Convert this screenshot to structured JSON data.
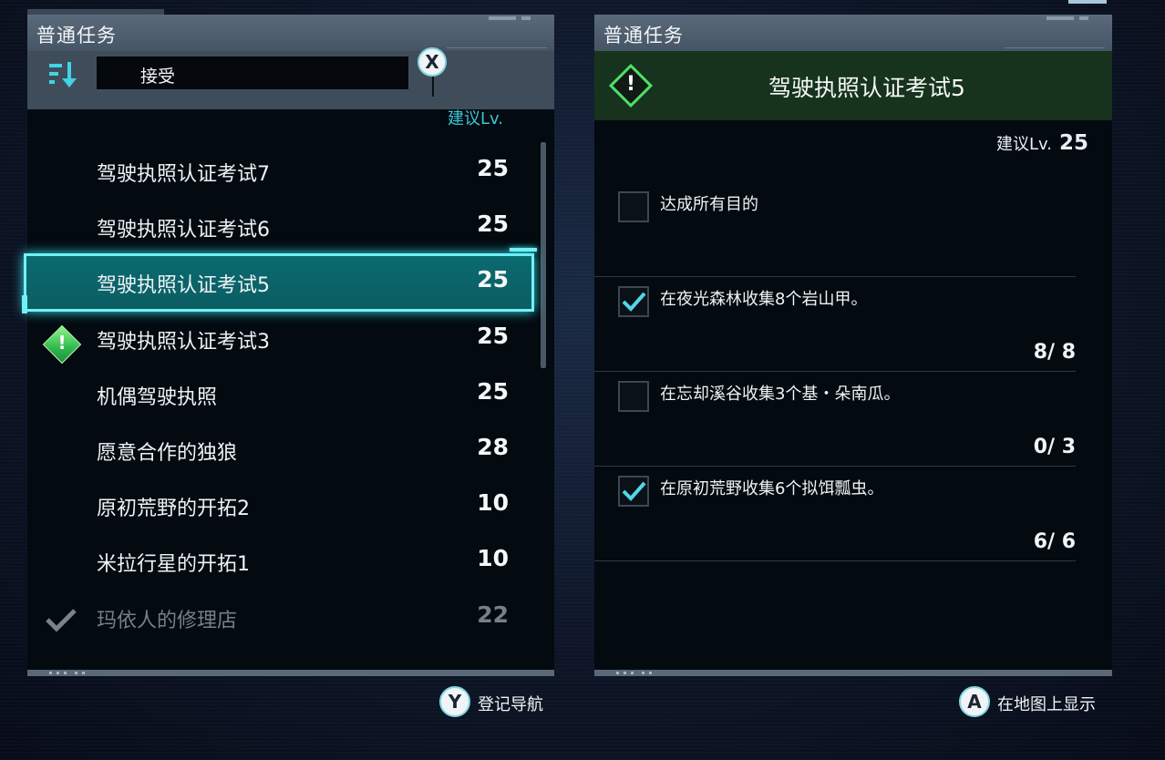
{
  "left_panel": {
    "title": "普通任务",
    "filter": "接受",
    "x_button": "X",
    "column_label": "建议Lv.",
    "quests": [
      {
        "name": "驾驶执照认证考试7",
        "level": "25"
      },
      {
        "name": "驾驶执照认证考试6",
        "level": "25"
      },
      {
        "name": "驾驶执照认证考试5",
        "level": "25"
      },
      {
        "name": "驾驶执照认证考试3",
        "level": "25"
      },
      {
        "name": "机偶驾驶执照",
        "level": "25"
      },
      {
        "name": "愿意合作的独狼",
        "level": "28"
      },
      {
        "name": "原初荒野的开拓2",
        "level": "10"
      },
      {
        "name": "米拉行星的开拓1",
        "level": "10"
      },
      {
        "name": "玛依人的修理店",
        "level": "22"
      }
    ]
  },
  "right_panel": {
    "title": "普通任务",
    "quest_title": "驾驶执照认证考试5",
    "rec_label": "建议Lv.",
    "rec_level": "25",
    "objectives": [
      {
        "text": "达成所有目的",
        "checked": false,
        "count": ""
      },
      {
        "text": "在夜光森林收集8个岩山甲。",
        "checked": true,
        "count": "8/ 8"
      },
      {
        "text": "在忘却溪谷收集3个基・朵南瓜。",
        "checked": false,
        "count": "0/ 3"
      },
      {
        "text": "在原初荒野收集6个拟饵瓢虫。",
        "checked": true,
        "count": "6/ 6"
      }
    ]
  },
  "hints": {
    "y_button": "Y",
    "y_label": "登记导航",
    "a_button": "A",
    "a_label": "在地图上显示"
  },
  "colors": {
    "accent": "#6ef2f7",
    "selected_bg": "#0b6469",
    "header_green": "#17331d",
    "diamond_green": "#2fb94e",
    "check_cyan": "#4fd8ea"
  }
}
